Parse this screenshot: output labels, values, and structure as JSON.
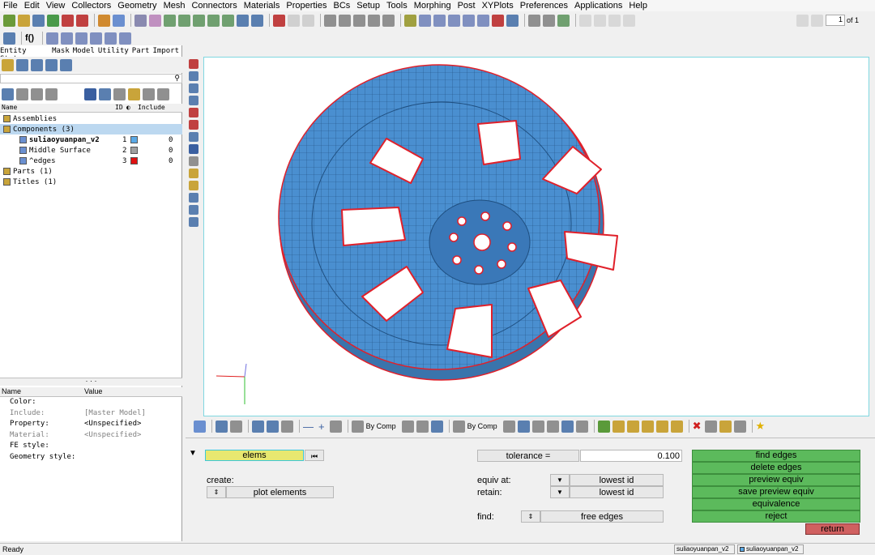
{
  "menubar": [
    "File",
    "Edit",
    "View",
    "Collectors",
    "Geometry",
    "Mesh",
    "Connectors",
    "Materials",
    "Properties",
    "BCs",
    "Setup",
    "Tools",
    "Morphing",
    "Post",
    "XYPlots",
    "Preferences",
    "Applications",
    "Help"
  ],
  "toolbar": {
    "page_value": "1",
    "page_of": "of 1",
    "func_label": "f()"
  },
  "left_tabs": [
    "Entity State",
    "Mask",
    "Model",
    "Utility",
    "Part",
    "Import"
  ],
  "tree": {
    "col_name": "Name",
    "col_id": "ID",
    "col_include": "Include",
    "rows": [
      {
        "label": "Assemblies",
        "id": "",
        "include": "",
        "color": "",
        "level": 0
      },
      {
        "label": "Components (3)",
        "id": "",
        "include": "",
        "color": "",
        "level": 0
      },
      {
        "label": "suliaoyuanpan_v2",
        "id": "1",
        "include": "0",
        "color": "#5aa9e6",
        "level": 1
      },
      {
        "label": "Middle Surface",
        "id": "2",
        "include": "0",
        "color": "#a0a0a0",
        "level": 1
      },
      {
        "label": "^edges",
        "id": "3",
        "include": "0",
        "color": "#e01010",
        "level": 1
      },
      {
        "label": "Parts (1)",
        "id": "",
        "include": "",
        "color": "",
        "level": 0
      },
      {
        "label": "Titles (1)",
        "id": "",
        "include": "",
        "color": "",
        "level": 0
      }
    ]
  },
  "props": {
    "col_name": "Name",
    "col_value": "Value",
    "rows": [
      {
        "k": "Color:",
        "v": ""
      },
      {
        "k": "Include:",
        "v": "[Master Model]"
      },
      {
        "k": "Property:",
        "v": "<Unspecified>"
      },
      {
        "k": "Material:",
        "v": "<Unspecified>"
      },
      {
        "k": "FE style:",
        "v": ""
      },
      {
        "k": "Geometry style:",
        "v": ""
      }
    ]
  },
  "view_toolbar": {
    "by_comp_1": "By Comp",
    "by_comp_2": "By Comp"
  },
  "panel": {
    "elems": "elems",
    "create_label": "create:",
    "create_value": "plot elements",
    "tolerance_label": "tolerance =",
    "tolerance_value": "0.100",
    "equiv_at_label": "equiv at:",
    "equiv_at_value": "lowest id",
    "retain_label": "retain:",
    "retain_value": "lowest id",
    "find_label": "find:",
    "find_value": "free edges",
    "actions": [
      "find edges",
      "delete edges",
      "preview equiv",
      "save preview equiv",
      "equivalence",
      "reject"
    ],
    "return_label": "return"
  },
  "status": {
    "text": "Ready",
    "model1": "suliaoyuanpan_v2",
    "model2": "suliaoyuanpan_v2"
  },
  "colors": {
    "mesh": "#4a8fd0",
    "edge": "#e0202a",
    "green": "#5cba5c",
    "return": "#d06060"
  }
}
